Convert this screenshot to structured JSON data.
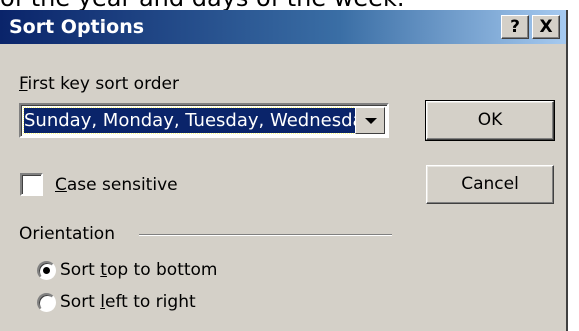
{
  "page": {
    "top_text": "of the year and days of the week."
  },
  "dialog": {
    "title": "Sort Options",
    "help_button": "?",
    "close_button": "X"
  },
  "sort_key": {
    "label_hotkey": "F",
    "label_rest": "irst key sort order",
    "value": "Sunday, Monday, Tuesday, Wednesday, Thursday, Friday, Saturday"
  },
  "buttons": {
    "ok": "OK",
    "cancel": "Cancel"
  },
  "case_sensitive": {
    "hotkey": "C",
    "rest": "ase sensitive",
    "checked": false
  },
  "orientation": {
    "label": "Orientation",
    "options": [
      {
        "pre": "Sort ",
        "hotkey": "t",
        "post": "op to bottom",
        "selected": true
      },
      {
        "pre": "Sort ",
        "hotkey": "l",
        "post": "eft to right",
        "selected": false
      }
    ]
  }
}
